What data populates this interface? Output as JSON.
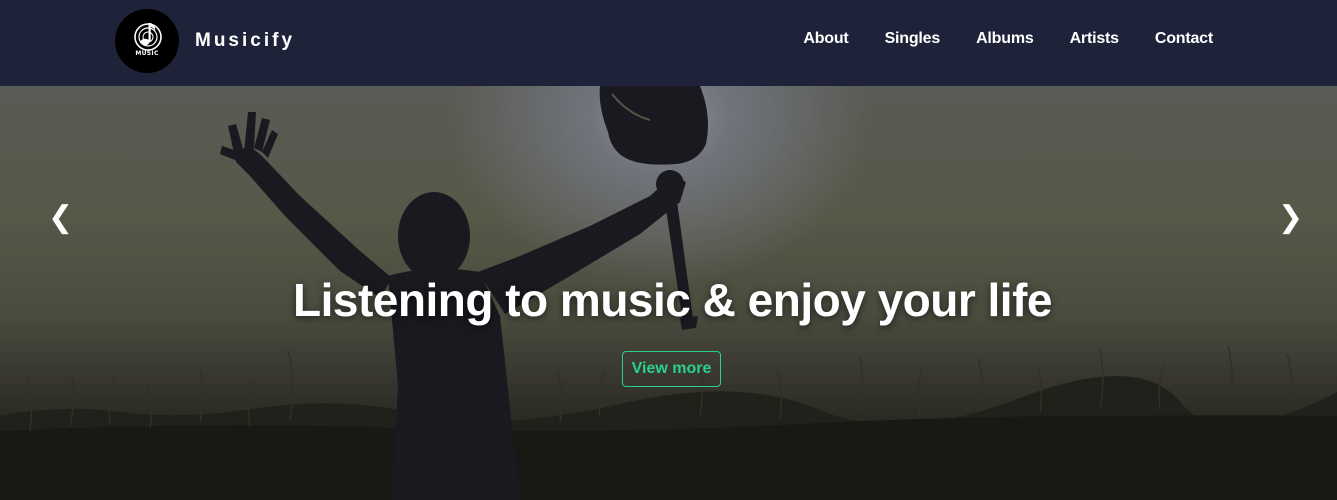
{
  "brand": {
    "name": "Musicify",
    "logo_text": "MUSIC",
    "logo_icon": "music-note-icon"
  },
  "nav": {
    "items": [
      {
        "label": "About"
      },
      {
        "label": "Singles"
      },
      {
        "label": "Albums"
      },
      {
        "label": "Artists"
      },
      {
        "label": "Contact"
      }
    ]
  },
  "hero": {
    "headline": "Listening to music & enjoy your life",
    "button_label": "View more",
    "prev_arrow": "❮",
    "next_arrow": "❯",
    "background_icon": "silhouette-with-guitar-image"
  },
  "colors": {
    "navbar": "#1e233a",
    "accent": "#2bd18a",
    "text": "#ffffff"
  }
}
